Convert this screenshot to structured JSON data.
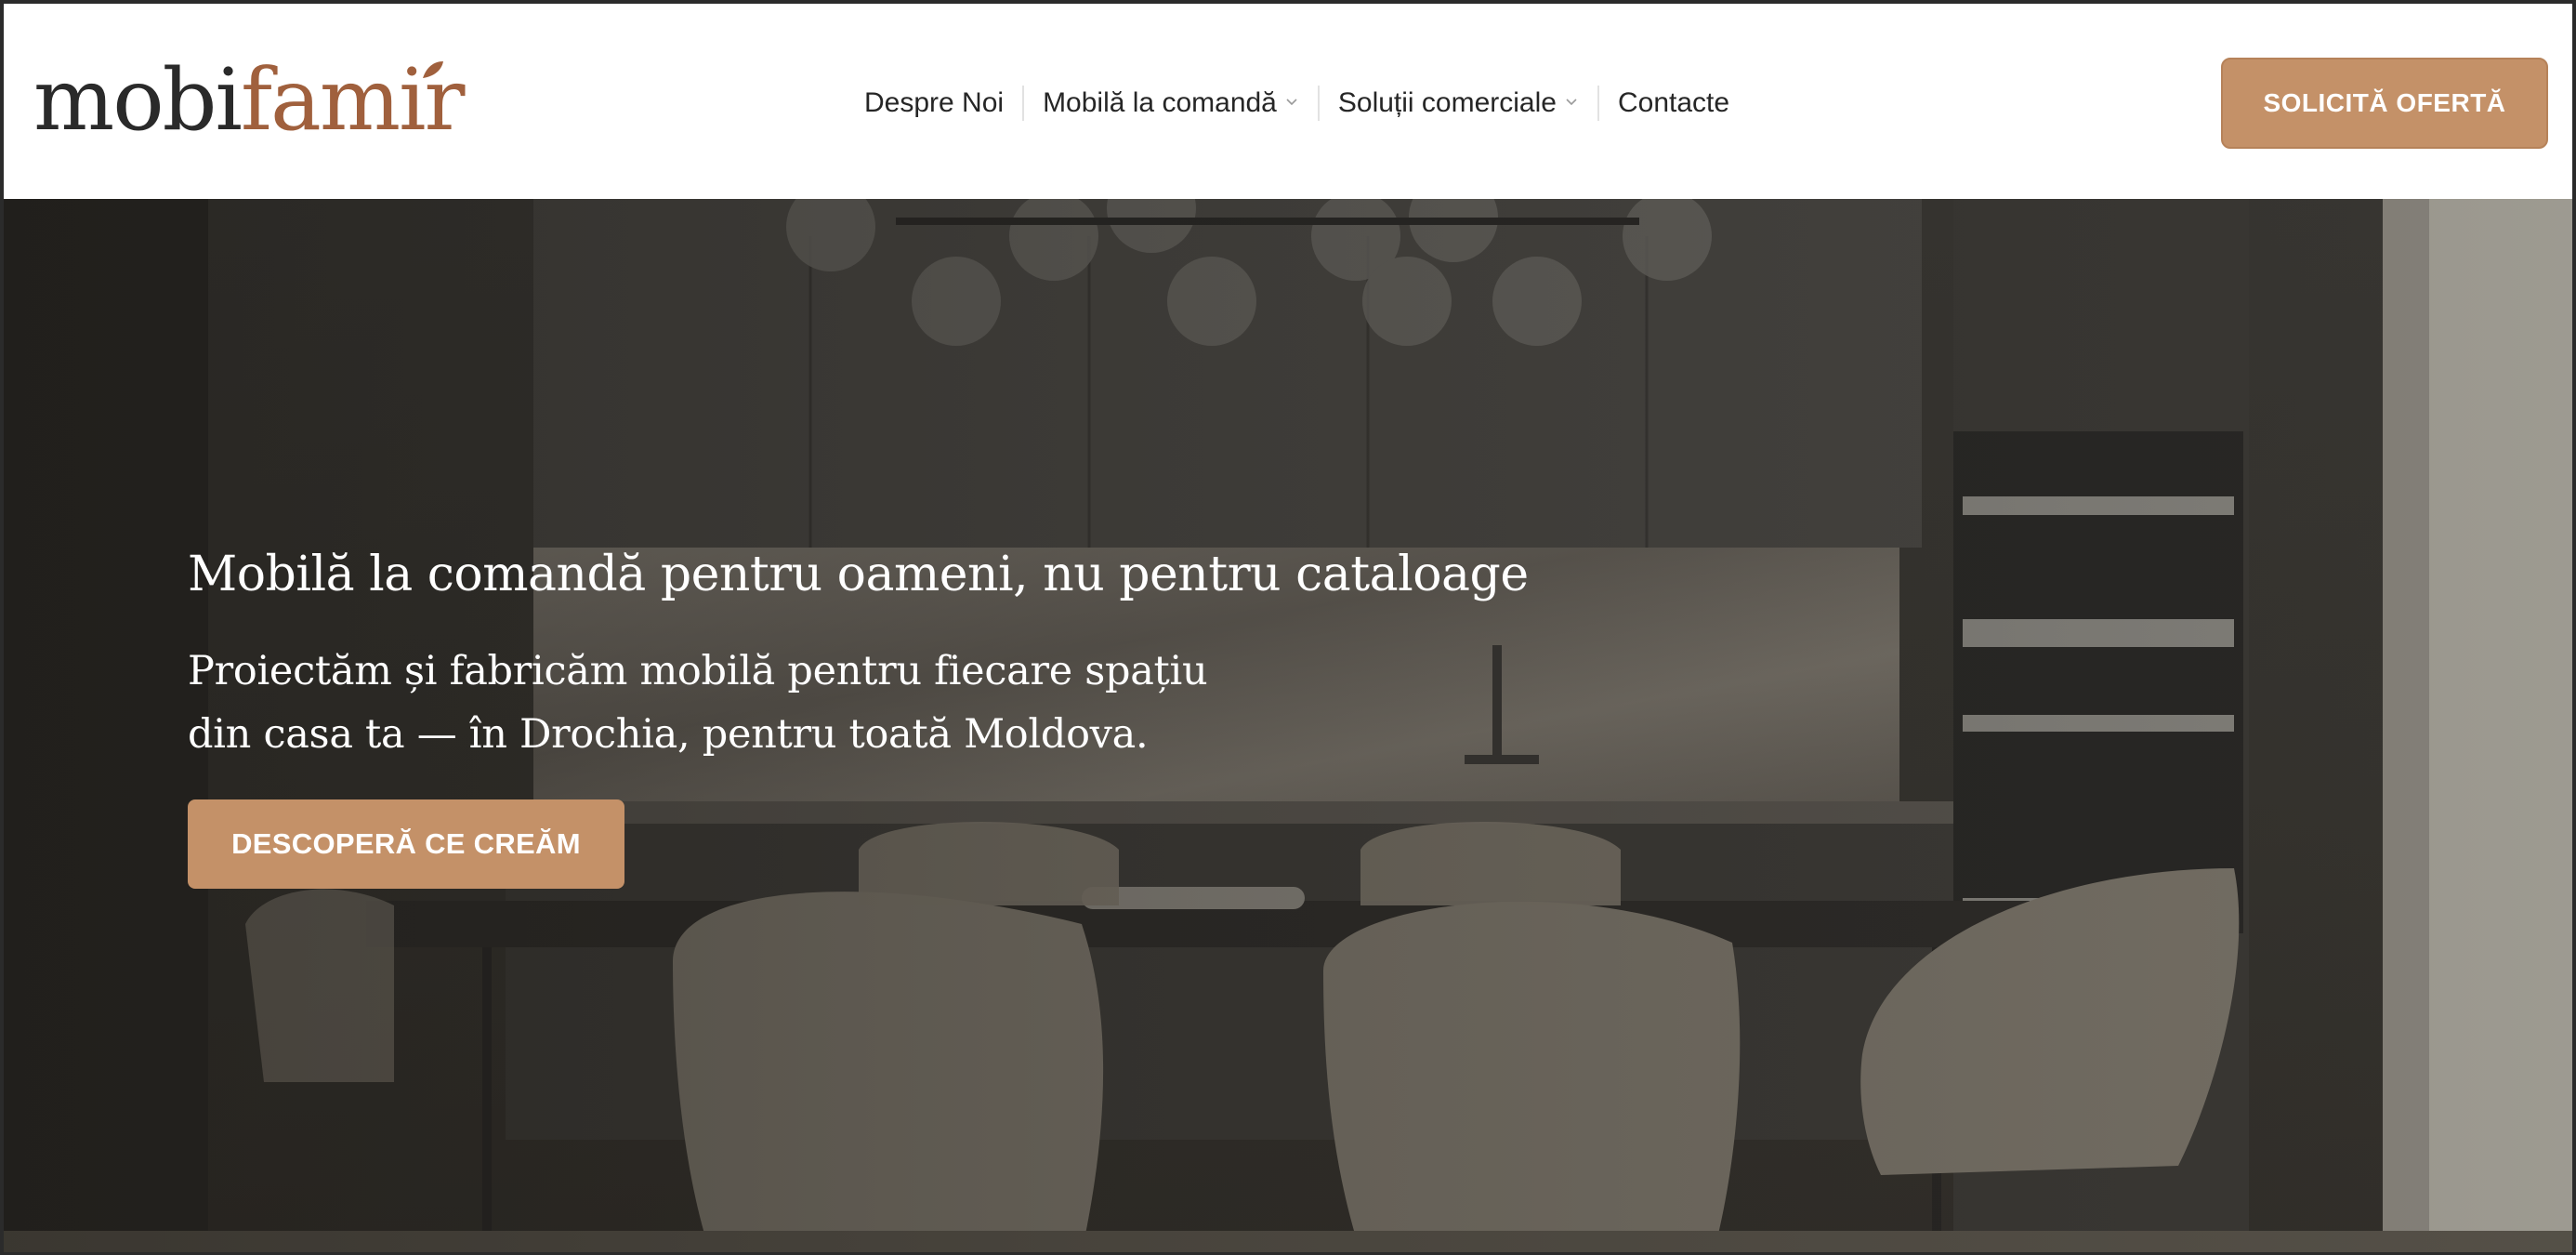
{
  "header": {
    "logo": {
      "part_dark": "mobi",
      "part_accent": "famir"
    },
    "nav": [
      {
        "label": "Despre Noi",
        "has_dropdown": false
      },
      {
        "label": "Mobilă la comandă",
        "has_dropdown": true
      },
      {
        "label": "Soluții comerciale",
        "has_dropdown": true
      },
      {
        "label": "Contacte",
        "has_dropdown": false
      }
    ],
    "cta_label": "SOLICITĂ OFERTĂ"
  },
  "hero": {
    "title": "Mobilă la comandă pentru oameni, nu pentru cataloage",
    "subtitle_line1": "Proiectăm și fabricăm mobilă pentru fiecare spațiu",
    "subtitle_line2": "din casa ta — în Drochia, pentru toată Moldova.",
    "cta_label": "DESCOPERĂ CE CREĂM"
  },
  "colors": {
    "accent": "#c49168",
    "logo_dark": "#2a2a2a",
    "logo_accent": "#a0603d",
    "nav_text": "#262626"
  },
  "icons": {
    "dropdown": "chevron-down-icon",
    "logo_mark": "leaf-icon"
  }
}
